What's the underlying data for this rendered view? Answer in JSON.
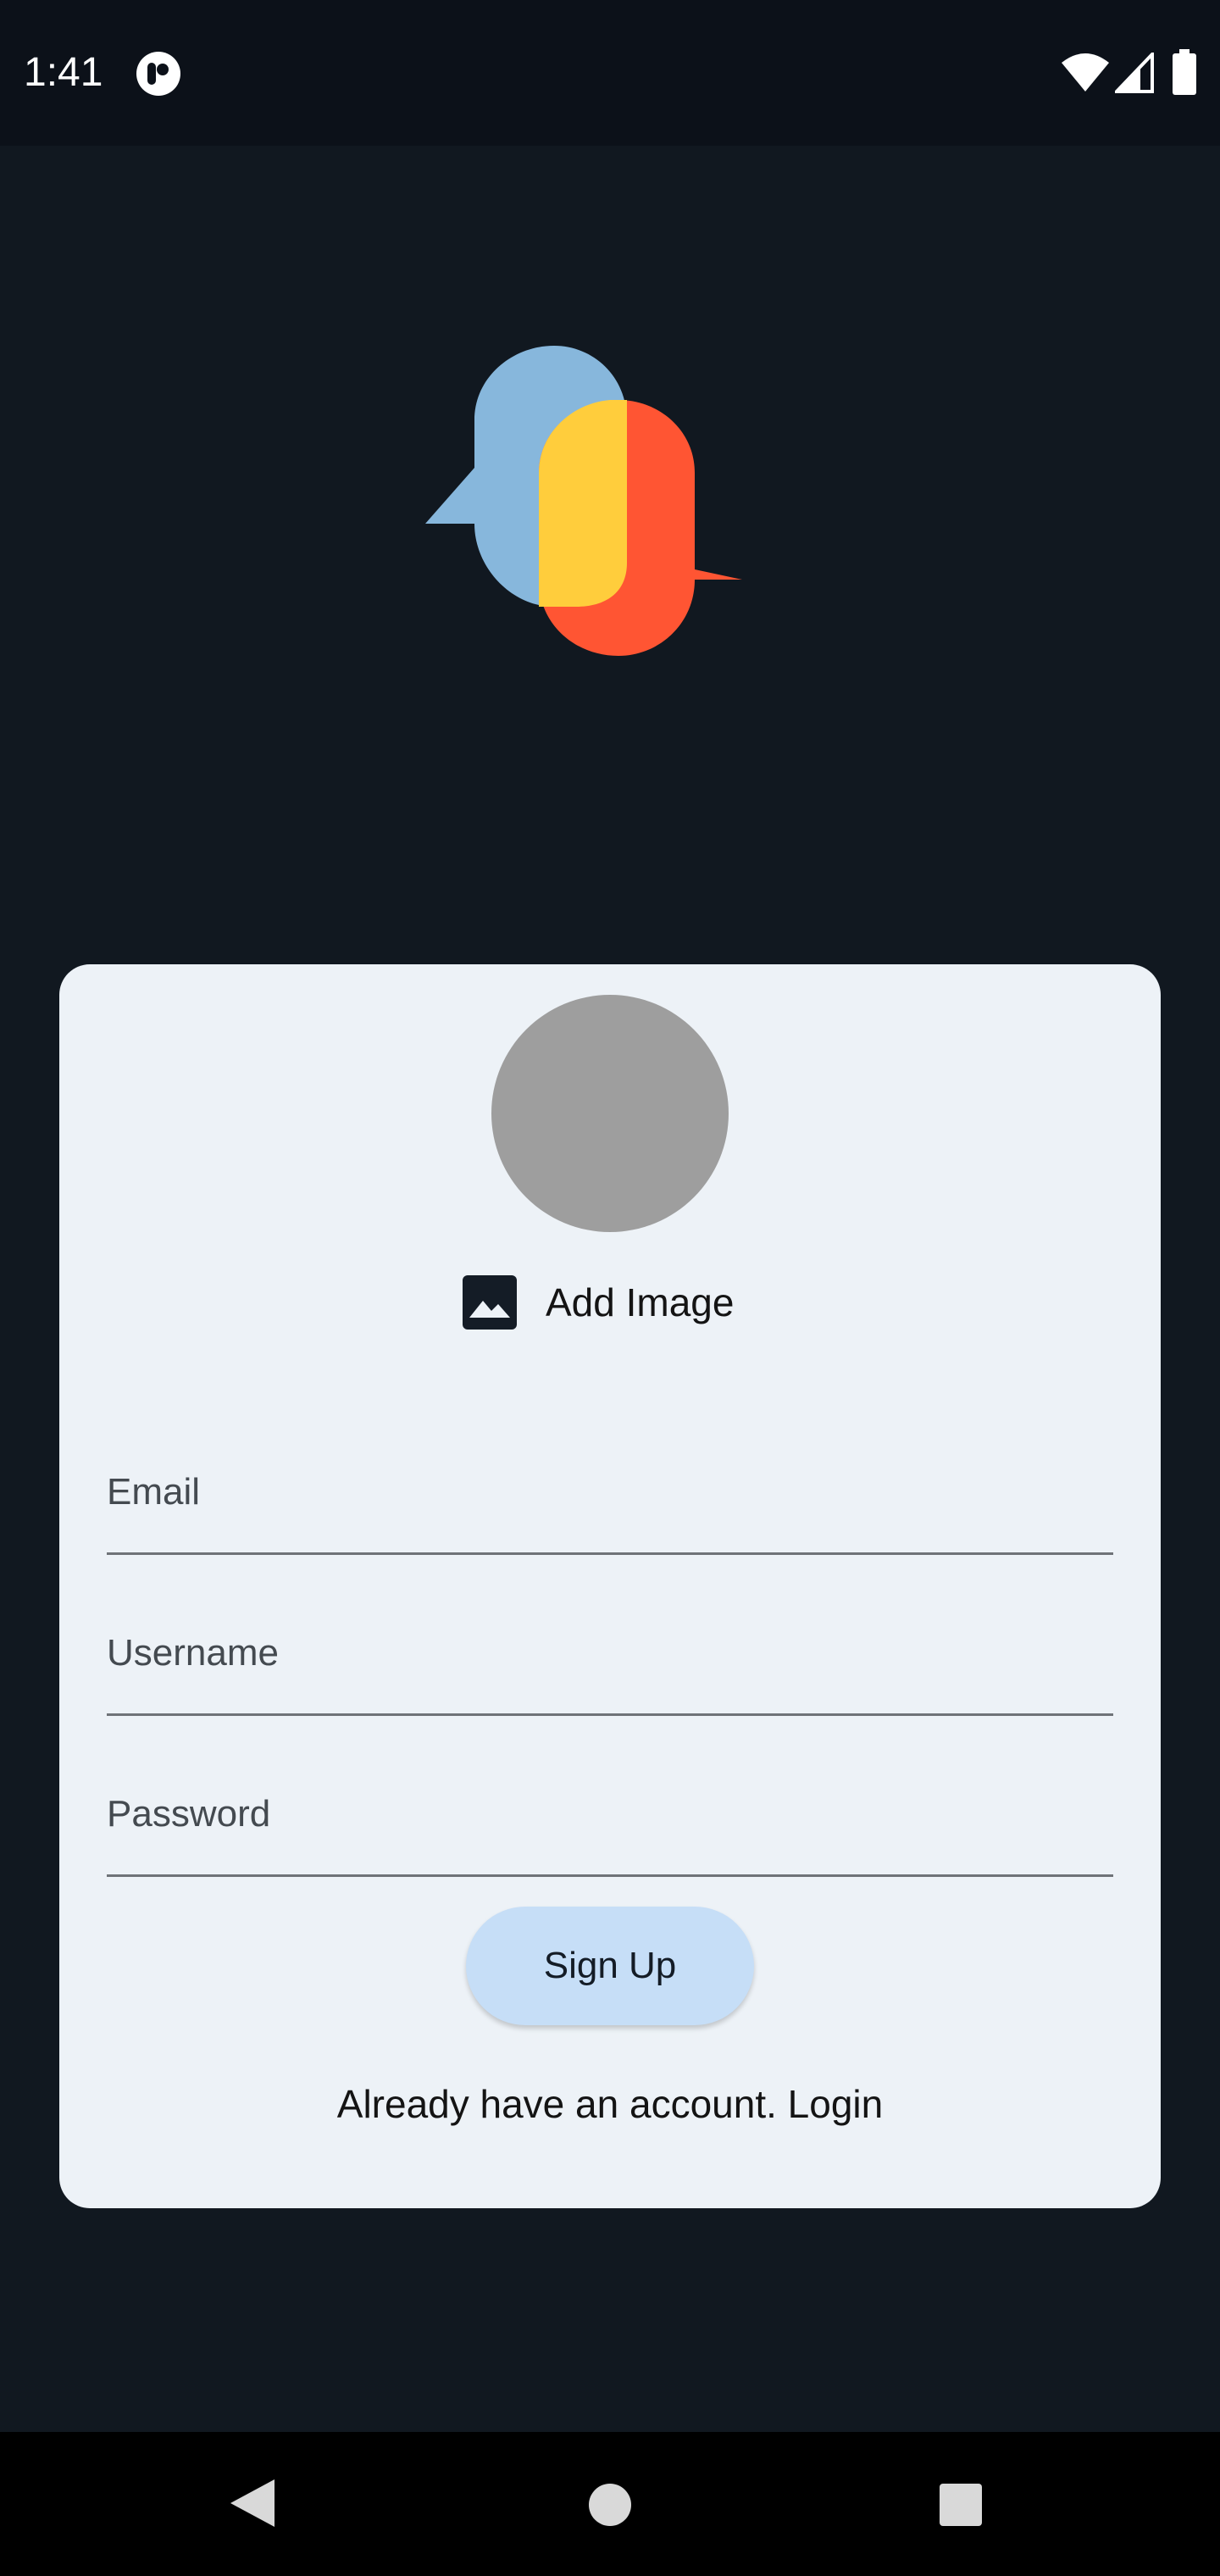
{
  "status_bar": {
    "time": "1:41"
  },
  "card": {
    "add_image_label": "Add Image",
    "email_placeholder": "Email",
    "username_placeholder": "Username",
    "password_placeholder": "Password",
    "signup_label": "Sign Up",
    "login_link": "Already have an account. Login"
  },
  "icons": {
    "status_app": "app-notification-icon",
    "wifi": "wifi-icon",
    "signal": "cell-signal-icon",
    "battery": "battery-icon",
    "add_image": "image-icon",
    "back": "back-triangle-icon",
    "home": "home-circle-icon",
    "recent": "recent-apps-square-icon"
  },
  "colors": {
    "background": "#111820",
    "card": "#edf2f7",
    "avatar": "#9e9e9e",
    "button": "#c6def7",
    "logo_blue": "#87b7dc",
    "logo_yellow": "#ffcd3c",
    "logo_red": "#ff5533"
  }
}
